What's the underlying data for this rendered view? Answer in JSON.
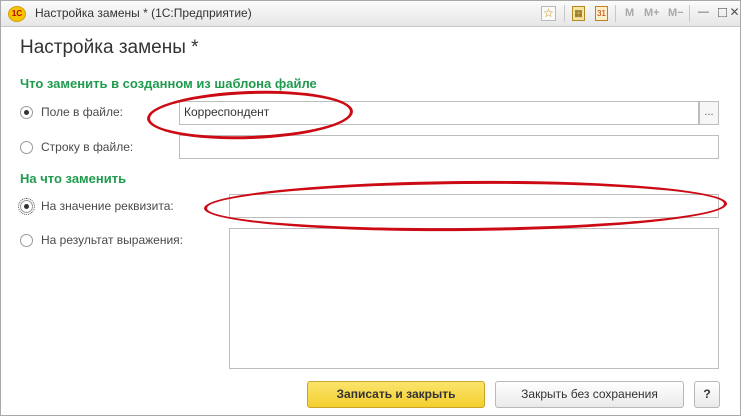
{
  "window": {
    "title": "Настройка замены * (1С:Предприятие)",
    "app_logo_icon": "1c-logo-icon",
    "toolbar": {
      "favorite_icon": "star-icon",
      "calculator_icon": "calculator-icon",
      "calendar_icon": "calendar-icon",
      "memory_buttons": [
        "M",
        "M+",
        "M−"
      ],
      "minimize_label": "—",
      "maximize_label": "□",
      "close_label": "✕"
    }
  },
  "form": {
    "title": "Настройка замены *",
    "what_to_replace": {
      "heading": "Что заменить в созданном из шаблона файле",
      "field_option": {
        "label": "Поле в файле:",
        "checked": true,
        "value": "Корреспондент",
        "select_button": "..."
      },
      "string_option": {
        "label": "Строку в файле:",
        "checked": false,
        "value": ""
      }
    },
    "replace_with": {
      "heading": "На что заменить",
      "attribute_option": {
        "label": "На значение реквизита:",
        "checked": true,
        "value": ""
      },
      "expression_option": {
        "label": "На результат выражения:",
        "checked": false,
        "value": ""
      }
    }
  },
  "buttons": {
    "save_close": "Записать и закрыть",
    "close_without_save": "Закрыть без сохранения",
    "help": "?"
  },
  "colors": {
    "heading_green": "#1f9b4e",
    "primary_button_yellow": "#f3cf2f",
    "annotation_red": "#cc0a14"
  }
}
